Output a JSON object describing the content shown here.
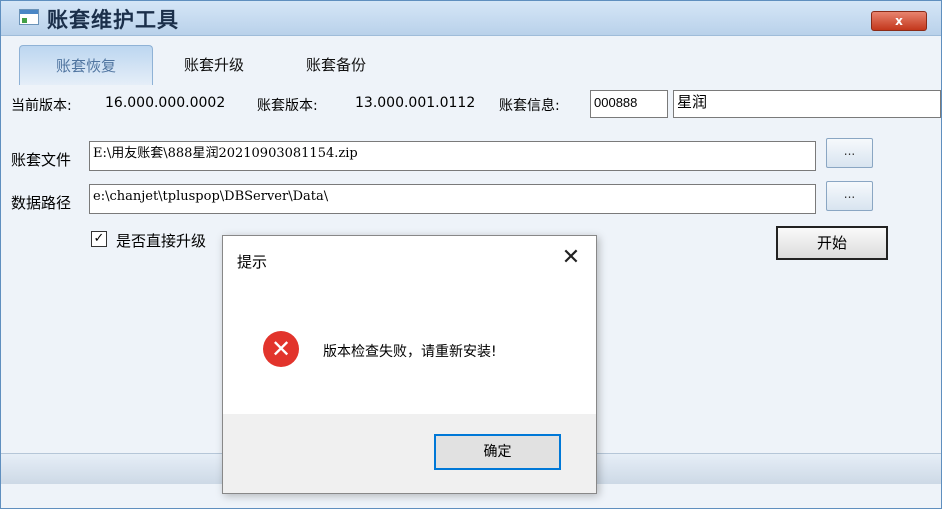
{
  "window": {
    "title": "账套维护工具",
    "close_label": "x"
  },
  "tabs": [
    {
      "label": "账套恢复",
      "active": true
    },
    {
      "label": "账套升级",
      "active": false
    },
    {
      "label": "账套备份",
      "active": false
    }
  ],
  "info": {
    "current_version_label": "当前版本:",
    "current_version": "16.000.000.0002",
    "account_version_label": "账套版本:",
    "account_version": "13.000.001.0112",
    "account_info_label": "账套信息:",
    "account_code": "000888",
    "account_name": "星润"
  },
  "file": {
    "label": "账套文件",
    "value": "E:\\用友账套\\888星润20210903081154.zip",
    "browse_label": "..."
  },
  "path": {
    "label": "数据路径",
    "value": "e:\\chanjet\\tpluspop\\DBServer\\Data\\",
    "browse_label": "..."
  },
  "upgrade": {
    "label": "是否直接升级",
    "checked": true,
    "check_glyph": "✓"
  },
  "start_button": "开始",
  "dialog": {
    "title": "提示",
    "close_glyph": "✕",
    "error_glyph": "✕",
    "message": "版本检查失败，请重新安装!",
    "ok_label": "确定"
  }
}
